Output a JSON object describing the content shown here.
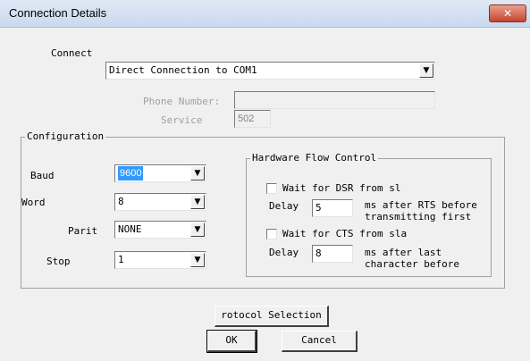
{
  "window": {
    "title": "Connection Details",
    "close_icon": "close-icon"
  },
  "connect": {
    "label": "Connect",
    "value": "Direct Connection to COM1",
    "phone_label": "Phone Number:",
    "phone_value": "",
    "service_label": "Service",
    "service_value": "502"
  },
  "configuration": {
    "legend": "Configuration",
    "baud_label": "Baud",
    "baud_value": "9600",
    "word_label": "Word",
    "word_value": "8",
    "parity_label": "Parit",
    "parity_value": "NONE",
    "stop_label": "Stop",
    "stop_value": "1"
  },
  "hardware": {
    "legend": "Hardware Flow Control",
    "dsr_label": "Wait for DSR from sl",
    "delay1_label": "Delay",
    "delay1_value": "5",
    "delay1_desc_line1": "ms after RTS before",
    "delay1_desc_line2": "transmitting first",
    "cts_label": "Wait for CTS from sla",
    "delay2_label": "Delay",
    "delay2_value": "8",
    "delay2_desc_line1": "ms after last",
    "delay2_desc_line2": "character before"
  },
  "buttons": {
    "protocol": "rotocol Selection",
    "ok": "OK",
    "cancel": "Cancel"
  }
}
